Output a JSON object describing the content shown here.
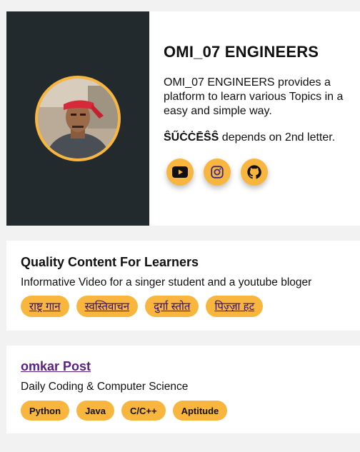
{
  "profile": {
    "name": "OMI_07 ENGINEERS",
    "description": "OMI_07 ENGINEERS provides a platform to learn various Topics in a easy and simple way.",
    "motto_bold": "ŜŰĊĊĒŜŜ",
    "motto_rest": " depends on 2nd letter.",
    "socials": [
      {
        "icon": "youtube-icon"
      },
      {
        "icon": "instagram-icon"
      },
      {
        "icon": "github-icon"
      }
    ]
  },
  "card1": {
    "title": "Quality Content For Learners",
    "subtitle": "Informative Video for a singer student and a youtube bloger",
    "tags": [
      "राष्ट्र गान",
      "स्वस्तिवाचन",
      "दुर्गा स्तोत",
      "पिज़्ज़ा हट"
    ]
  },
  "card2": {
    "title": "omkar Post",
    "subtitle": "Daily Coding & Computer Science",
    "tags": [
      "Python",
      "Java",
      "C/C++",
      "Aptitude"
    ]
  },
  "colors": {
    "accent": "#f8b63f",
    "dark_panel": "#222a2d",
    "link": "#5a1f86"
  }
}
